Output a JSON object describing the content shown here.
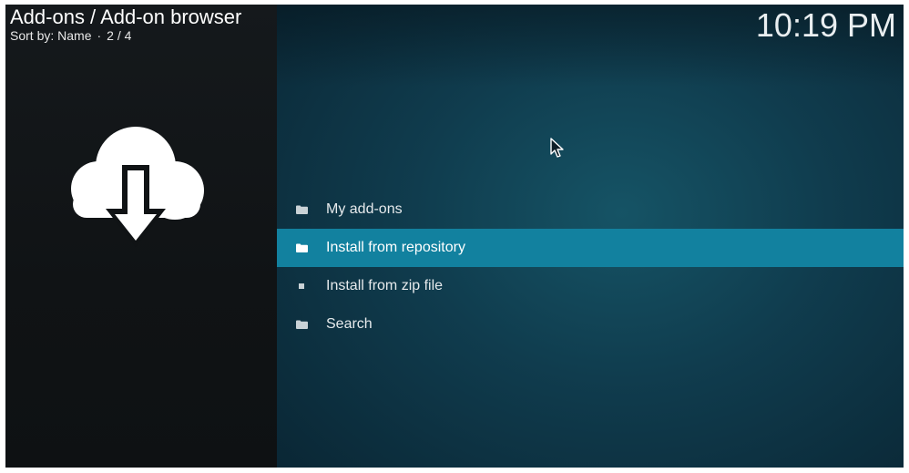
{
  "header": {
    "title": "Add-ons / Add-on browser",
    "sort_by": "Sort by: Name",
    "separator": "·",
    "position": "2 / 4"
  },
  "clock": "10:19 PM",
  "hero_icon": "cloud-download-icon",
  "menu": {
    "items": [
      {
        "label": "My add-ons",
        "icon": "folder-icon",
        "focused": false
      },
      {
        "label": "Install from repository",
        "icon": "folder-icon",
        "focused": true
      },
      {
        "label": "Install from zip file",
        "icon": "square-icon",
        "focused": false
      },
      {
        "label": "Search",
        "icon": "folder-icon",
        "focused": false
      }
    ]
  },
  "colors": {
    "focus_bar": "#12819f",
    "panel_bg": "#121618",
    "main_bg": "#0e3445",
    "text": "#e6eaec"
  }
}
